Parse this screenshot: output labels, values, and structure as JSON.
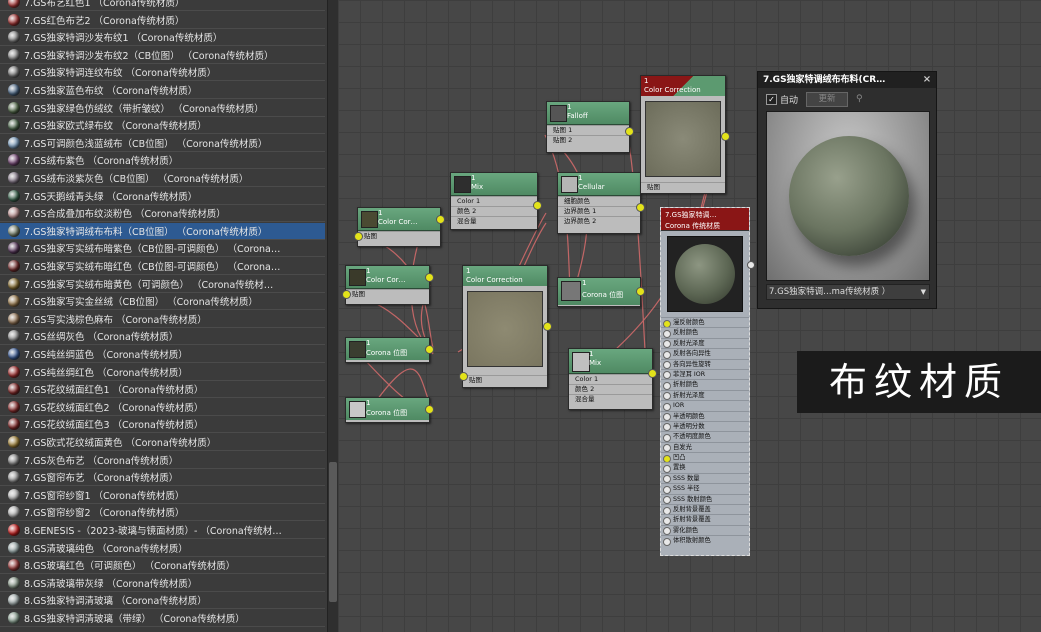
{
  "material_list": {
    "items": [
      {
        "label": "7.GS布艺红色1  （Corona传统材质）",
        "color": "#b23a3a"
      },
      {
        "label": "7.GS红色布艺2  （Corona传统材质）",
        "color": "#a83535"
      },
      {
        "label": "7.GS独家特调沙发布纹1  （Corona传统材质）",
        "color": "#8a8a8a"
      },
      {
        "label": "7.GS独家特调沙发布纹2（CB位图）  （Corona传统材质）",
        "color": "#8f8f8f"
      },
      {
        "label": "7.GS独家特调连纹布纹  （Corona传统材质）",
        "color": "#7d7d7d"
      },
      {
        "label": "7.GS独家蓝色布纹  （Corona传统材质）",
        "color": "#4f6c8c"
      },
      {
        "label": "7.GS独家绿色仿绒纹（带折皱纹）  （Corona传统材质）",
        "color": "#58704e"
      },
      {
        "label": "7.GS独家欧式绿布纹  （Corona传统材质）",
        "color": "#4d6a4d"
      },
      {
        "label": "7.GS可调颜色浅蓝绒布（CB位图）  （Corona传统材质）",
        "color": "#7fa3c6"
      },
      {
        "label": "7.GS绒布紫色  （Corona传统材质）",
        "color": "#7a4a7a"
      },
      {
        "label": "7.GS绒布淡紫灰色（CB位图）  （Corona传统材质）",
        "color": "#8c7f90"
      },
      {
        "label": "7.GS天鹅绒青头绿  （Corona传统材质）",
        "color": "#3d6a52"
      },
      {
        "label": "7.GS合成叠加布纹淡粉色  （Corona传统材质）",
        "color": "#c89a9a"
      },
      {
        "label": "7.GS独家特调绒布布料（CB位图）  （Corona传统材质）",
        "color": "#7a8670"
      },
      {
        "label": "7.GS独家写实绒布暗紫色（CB位图-可调颜色）  （Corona…",
        "color": "#5e3c62"
      },
      {
        "label": "7.GS独家写实绒布暗红色（CB位图-可调颜色）  （Corona…",
        "color": "#7a2f2f"
      },
      {
        "label": "7.GS独家写实绒布暗黄色（可调颜色）  （Corona传统材…",
        "color": "#8a7030"
      },
      {
        "label": "7.GS独家写实金丝绒（CB位图）  （Corona传统材质）",
        "color": "#a08050"
      },
      {
        "label": "7.GS写实浅棕色麻布  （Corona传统材质）",
        "color": "#9a7a5a"
      },
      {
        "label": "7.GS丝绸灰色  （Corona传统材质）",
        "color": "#9a9a9a"
      },
      {
        "label": "7.GS纯丝绸蓝色  （Corona传统材质）",
        "color": "#3a5c9a"
      },
      {
        "label": "7.GS纯丝绸红色  （Corona传统材质）",
        "color": "#a83030"
      },
      {
        "label": "7.GS花纹绒面红色1  （Corona传统材质）",
        "color": "#8a2a2a"
      },
      {
        "label": "7.GS花纹绒面红色2  （Corona传统材质）",
        "color": "#902e2e"
      },
      {
        "label": "7.GS花纹绒面红色3  （Corona传统材质）",
        "color": "#862828"
      },
      {
        "label": "7.GS欧式花纹绒面黄色  （Corona传统材质）",
        "color": "#a8883a"
      },
      {
        "label": "7.GS灰色布艺  （Corona传统材质）",
        "color": "#8a8a8a"
      },
      {
        "label": "7.GS窗帘布艺  （Corona传统材质）",
        "color": "#a0a0a0"
      },
      {
        "label": "7.GS窗帘纱窗1  （Corona传统材质）",
        "color": "#c0c0c0"
      },
      {
        "label": "7.GS窗帘纱窗2  （Corona传统材质）",
        "color": "#bdbdbd"
      },
      {
        "label": "8.GENESIS  -（2023-玻璃与镜面材质）-  （Corona传统材…",
        "color": "#d02020"
      },
      {
        "label": "8.GS清玻璃纯色  （Corona传统材质）",
        "color": "#9fb0b0"
      },
      {
        "label": "8.GS玻璃红色（可调颜色）  （Corona传统材质）",
        "color": "#a03a3a"
      },
      {
        "label": "8.GS清玻璃带灰绿  （Corona传统材质）",
        "color": "#8fa090"
      },
      {
        "label": "8.GS独家特调清玻璃  （Corona传统材质）",
        "color": "#a8b4b4"
      },
      {
        "label": "8.GS独家特调清玻璃（带绿）  （Corona传统材质）",
        "color": "#90a898"
      }
    ],
    "selected_index": 13
  },
  "nodes": {
    "cc1": {
      "num": "1",
      "title": "Color Cor…",
      "slot": "贴图"
    },
    "cc2": {
      "num": "1",
      "title": "Color Cor…",
      "slot": "贴图"
    },
    "bitmap1": {
      "num": "1",
      "title": "Corona 位图"
    },
    "bitmap2": {
      "num": "1",
      "title": "Corona 位图"
    },
    "mix1": {
      "num": "1",
      "title": "Mix",
      "slots": [
        "Color 1",
        "颜色 2",
        "混合量"
      ]
    },
    "falloff": {
      "num": "1",
      "title": "Falloff",
      "slots": [
        "贴图 1",
        "贴图 2"
      ]
    },
    "cellular": {
      "num": "1",
      "title": "Cellular",
      "slots": [
        "细胞颜色",
        "边界颜色 1",
        "边界颜色 2"
      ]
    },
    "cc3": {
      "num": "1",
      "title": "Color Correction",
      "slot": "贴图"
    },
    "cc_top": {
      "num": "1",
      "title": "Color Correction",
      "slot": "贴图"
    },
    "bitmap3": {
      "num": "1",
      "title": "Corona 位图"
    },
    "mix2": {
      "num": "1",
      "title": "Mix",
      "slots": [
        "Color 1",
        "颜色 2",
        "混合量"
      ]
    }
  },
  "material_node": {
    "title1": "7.GS独家特调…",
    "title2": "Corona 传统材质",
    "params": [
      "漫反射颜色",
      "反射颜色",
      "反射光泽度",
      "反射各向异性",
      "各向异性旋转",
      "菲涅耳 IOR",
      "折射颜色",
      "折射光泽度",
      "IOR",
      "半透明颜色",
      "半透明分数",
      "不透明度颜色",
      "自发光",
      "凹凸",
      "置换",
      "SSS 数量",
      "SSS 半径",
      "SSS 散射颜色",
      "反射背景覆盖",
      "折射背景覆盖",
      "雾化颜色",
      "体积散射颜色"
    ],
    "linked": [
      0,
      13
    ]
  },
  "preview_window": {
    "title": "7.GS独家特调绒布布料(CR…",
    "close": "×",
    "auto_label": "自动",
    "update_label": "更新",
    "dropdown_value": "7.GS独家特调…ma传统材质 ）"
  },
  "caption": "布纹材质",
  "colors": {
    "node_green": "#5c9a70",
    "port_yellow": "#e3e31a",
    "wire": "#d06a6a",
    "selected": "#2d5a92"
  }
}
